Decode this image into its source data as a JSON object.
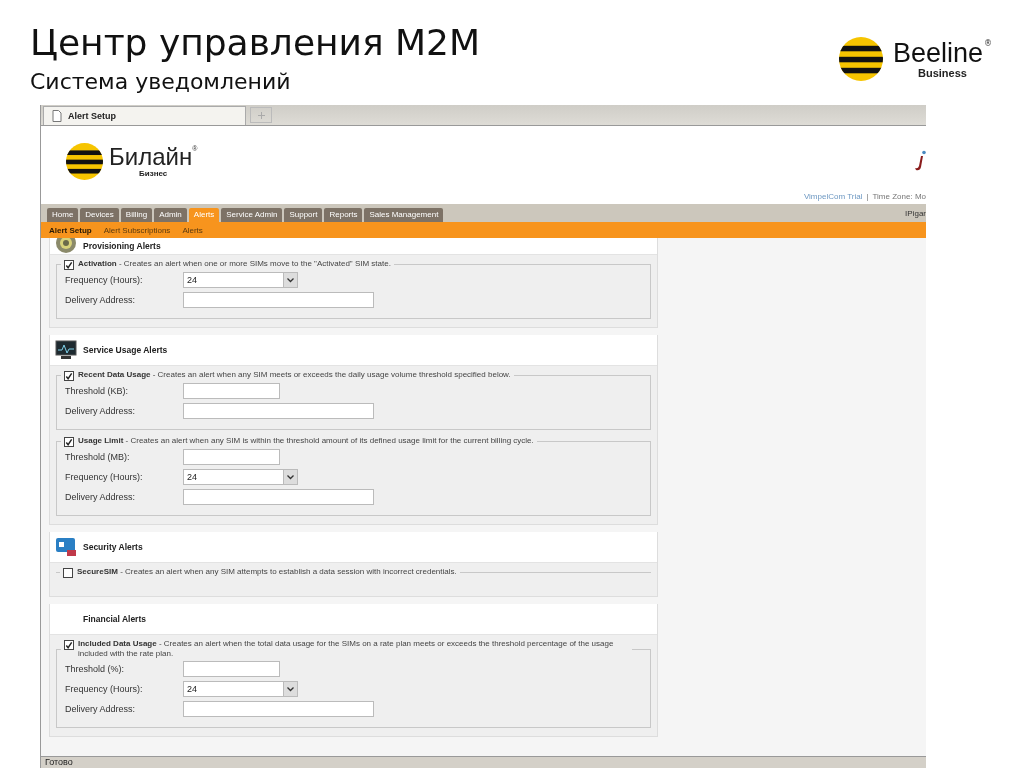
{
  "slide": {
    "title": "Центр управления M2M",
    "subtitle": "Система уведомлений",
    "logo": {
      "name": "Beeline",
      "mark": "®",
      "tagline": "Business"
    }
  },
  "browser": {
    "tabs": [
      {
        "label": "Alert Setup",
        "selected": true
      }
    ],
    "status_bar": "Готово"
  },
  "site": {
    "logo": {
      "name": "Билайн",
      "mark": "®",
      "tagline": "Бизнес"
    },
    "account": {
      "link": "VimpelCom Trial",
      "separator": "|",
      "time_zone": "Time Zone: Mo"
    },
    "nav": [
      {
        "label": "Home",
        "selected": false
      },
      {
        "label": "Devices",
        "selected": false
      },
      {
        "label": "Billing",
        "selected": false
      },
      {
        "label": "Admin",
        "selected": false
      },
      {
        "label": "Alerts",
        "selected": true
      },
      {
        "label": "Service Admin",
        "selected": false
      },
      {
        "label": "Support",
        "selected": false
      },
      {
        "label": "Reports",
        "selected": false
      },
      {
        "label": "Sales Management",
        "selected": false
      }
    ],
    "user": "IPigar",
    "subnav": [
      {
        "label": "Alert Setup",
        "selected": true
      },
      {
        "label": "Alert Subscriptions",
        "selected": false
      },
      {
        "label": "Alerts",
        "selected": false
      }
    ]
  },
  "sections": [
    {
      "kind": "provisioning",
      "title": "Provisioning Alerts",
      "alerts": [
        {
          "name": "Activation",
          "description": "- Creates an alert when one or more SIMs move to the \"Activated\" SIM state.",
          "checked": true,
          "fields": [
            {
              "label": "Frequency (Hours):",
              "kind": "select",
              "value": "24"
            },
            {
              "label": "Delivery Address:",
              "kind": "address"
            }
          ]
        }
      ]
    },
    {
      "kind": "usage",
      "title": "Service Usage Alerts",
      "alerts": [
        {
          "name": "Recent Data Usage",
          "description": "- Creates an alert when any SIM meets or exceeds the daily usage volume threshold specified below.",
          "checked": true,
          "fields": [
            {
              "label": "Threshold (KB):",
              "kind": "number"
            },
            {
              "label": "Delivery Address:",
              "kind": "address"
            }
          ]
        },
        {
          "name": "Usage Limit",
          "description": "- Creates an alert when any SIM is within the threshold amount of its defined usage limit for the current billing cycle.",
          "checked": true,
          "fields": [
            {
              "label": "Threshold (MB):",
              "kind": "number"
            },
            {
              "label": "Frequency (Hours):",
              "kind": "select",
              "value": "24"
            },
            {
              "label": "Delivery Address:",
              "kind": "address"
            }
          ]
        }
      ]
    },
    {
      "kind": "security",
      "title": "Security Alerts",
      "alerts": [
        {
          "name": "SecureSIM",
          "description": "- Creates an alert when any SIM attempts to establish a data session with incorrect credentials.",
          "checked": false
        }
      ]
    },
    {
      "kind": "financial",
      "title": "Financial Alerts",
      "alerts": [
        {
          "name": "Included Data Usage",
          "description": "- Creates an alert when the total data usage for the SIMs on a rate plan meets or exceeds the threshold percentage of the usage included with the rate plan.",
          "checked": true,
          "fields": [
            {
              "label": "Threshold (%):",
              "kind": "number"
            },
            {
              "label": "Frequency (Hours):",
              "kind": "select",
              "value": "24"
            },
            {
              "label": "Delivery Address:",
              "kind": "address"
            }
          ]
        }
      ]
    }
  ]
}
